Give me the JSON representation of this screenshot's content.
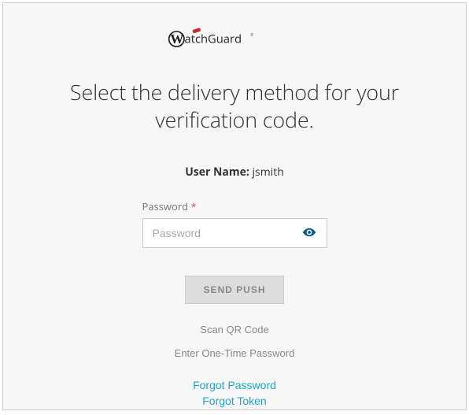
{
  "brand": "WatchGuard",
  "heading": "Select the delivery method for your verification code.",
  "username": {
    "label": "User Name",
    "value": "jsmith"
  },
  "password": {
    "label": "Password",
    "required_mark": "*",
    "placeholder": "Password",
    "value": ""
  },
  "buttons": {
    "send_push": "SEND PUSH",
    "scan_qr": "Scan QR Code",
    "enter_otp": "Enter One-Time Password",
    "forgot_password": "Forgot Password",
    "forgot_token": "Forgot Token"
  }
}
